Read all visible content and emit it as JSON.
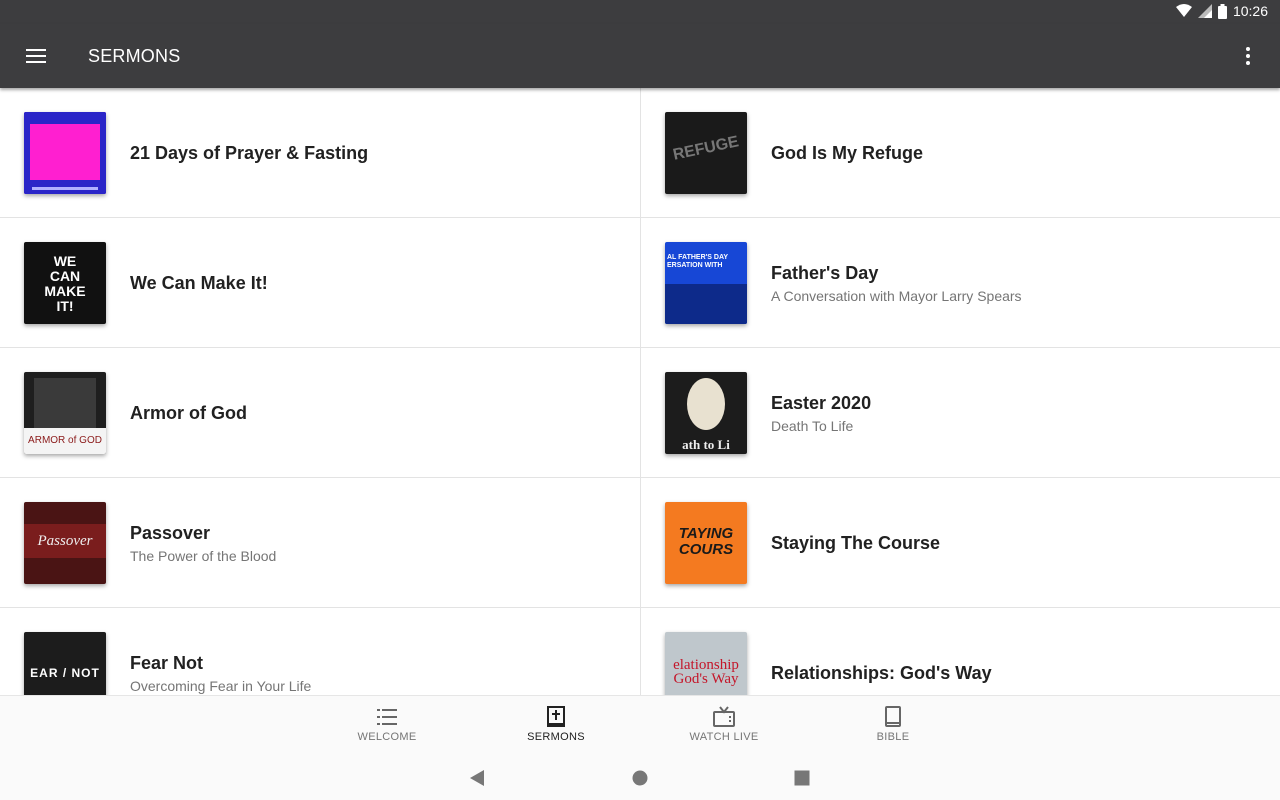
{
  "status": {
    "time": "10:26"
  },
  "appbar": {
    "title": "SERMONS"
  },
  "sermons_left": [
    {
      "title": "21 Days of Prayer & Fasting",
      "subtitle": ""
    },
    {
      "title": "We Can Make It!",
      "subtitle": "",
      "art_text": "WE CAN MAKE IT!"
    },
    {
      "title": "Armor of God",
      "subtitle": "",
      "art_text": "ARMOR of GOD"
    },
    {
      "title": "Passover",
      "subtitle": "The Power of the Blood",
      "art_text": "Passover"
    },
    {
      "title": "Fear Not",
      "subtitle": "Overcoming Fear in Your Life",
      "art_text": "EAR / NOT"
    }
  ],
  "sermons_right": [
    {
      "title": "God Is My Refuge",
      "subtitle": "",
      "art_text": "REFUGE"
    },
    {
      "title": "Father's Day",
      "subtitle": "A Conversation with Mayor Larry Spears",
      "art_text": "AL FATHER'S DAY ERSATION WITH"
    },
    {
      "title": "Easter 2020",
      "subtitle": "Death To Life",
      "art_text": "ath to Li"
    },
    {
      "title": "Staying The Course",
      "subtitle": "",
      "art_text": "TAYING COURS"
    },
    {
      "title": "Relationships: God's Way",
      "subtitle": "",
      "art_text": "elationship God's Way"
    }
  ],
  "bottom_nav": [
    {
      "label": "WELCOME",
      "icon": "list-icon"
    },
    {
      "label": "SERMONS",
      "icon": "bible-cross-icon",
      "active": true
    },
    {
      "label": "WATCH LIVE",
      "icon": "tv-icon"
    },
    {
      "label": "BIBLE",
      "icon": "book-icon"
    }
  ],
  "colors": {
    "appbar": "#3d3d3f",
    "divider": "#e3e3e3",
    "title_text": "#212121",
    "subtitle_text": "#757575"
  }
}
